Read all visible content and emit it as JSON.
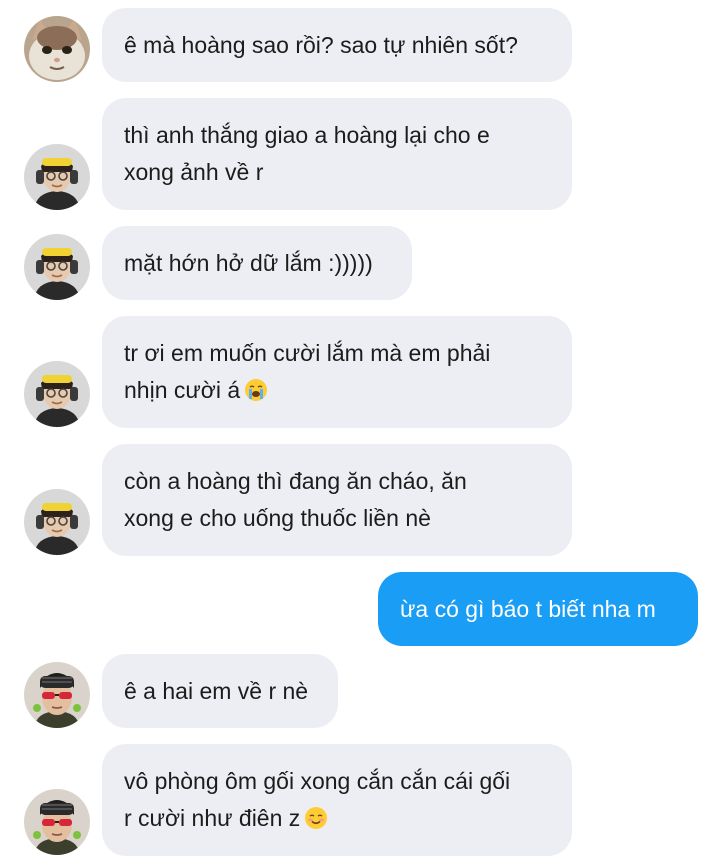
{
  "messages": [
    {
      "sender": "cat",
      "direction": "incoming",
      "lines": [
        "ê mà hoàng sao rồi? sao tự nhiên sốt?"
      ]
    },
    {
      "sender": "friend-headset",
      "direction": "incoming",
      "lines": [
        "thì anh thắng giao a hoàng lại cho e",
        "xong ảnh về r"
      ]
    },
    {
      "sender": "friend-headset",
      "direction": "incoming",
      "lines": [
        "mặt hớn hở dữ lắm :)))))"
      ]
    },
    {
      "sender": "friend-headset",
      "direction": "incoming",
      "lines": [
        "tr ơi em muốn cười lắm mà em phải",
        "nhịn cười á"
      ],
      "emoji": "loudly-crying-face-icon"
    },
    {
      "sender": "friend-headset",
      "direction": "incoming",
      "lines": [
        "còn a hoàng thì đang ăn cháo, ăn",
        "xong e cho uống thuốc liền nè"
      ]
    },
    {
      "sender": "me",
      "direction": "outgoing",
      "lines": [
        "ừa có gì báo t biết nha m"
      ]
    },
    {
      "sender": "friend-sunglasses",
      "direction": "incoming",
      "lines": [
        "ê a hai em về r nè"
      ]
    },
    {
      "sender": "friend-sunglasses",
      "direction": "incoming",
      "lines": [
        "vô phòng ôm gối xong cắn cắn cái gối",
        "r cười như điên z"
      ],
      "emoji": "smiling-face-icon"
    }
  ],
  "colors": {
    "incoming_bubble": "#eceef3",
    "outgoing_bubble": "#1a9df5",
    "incoming_text": "#1c1c1c",
    "outgoing_text": "#ffffff"
  }
}
